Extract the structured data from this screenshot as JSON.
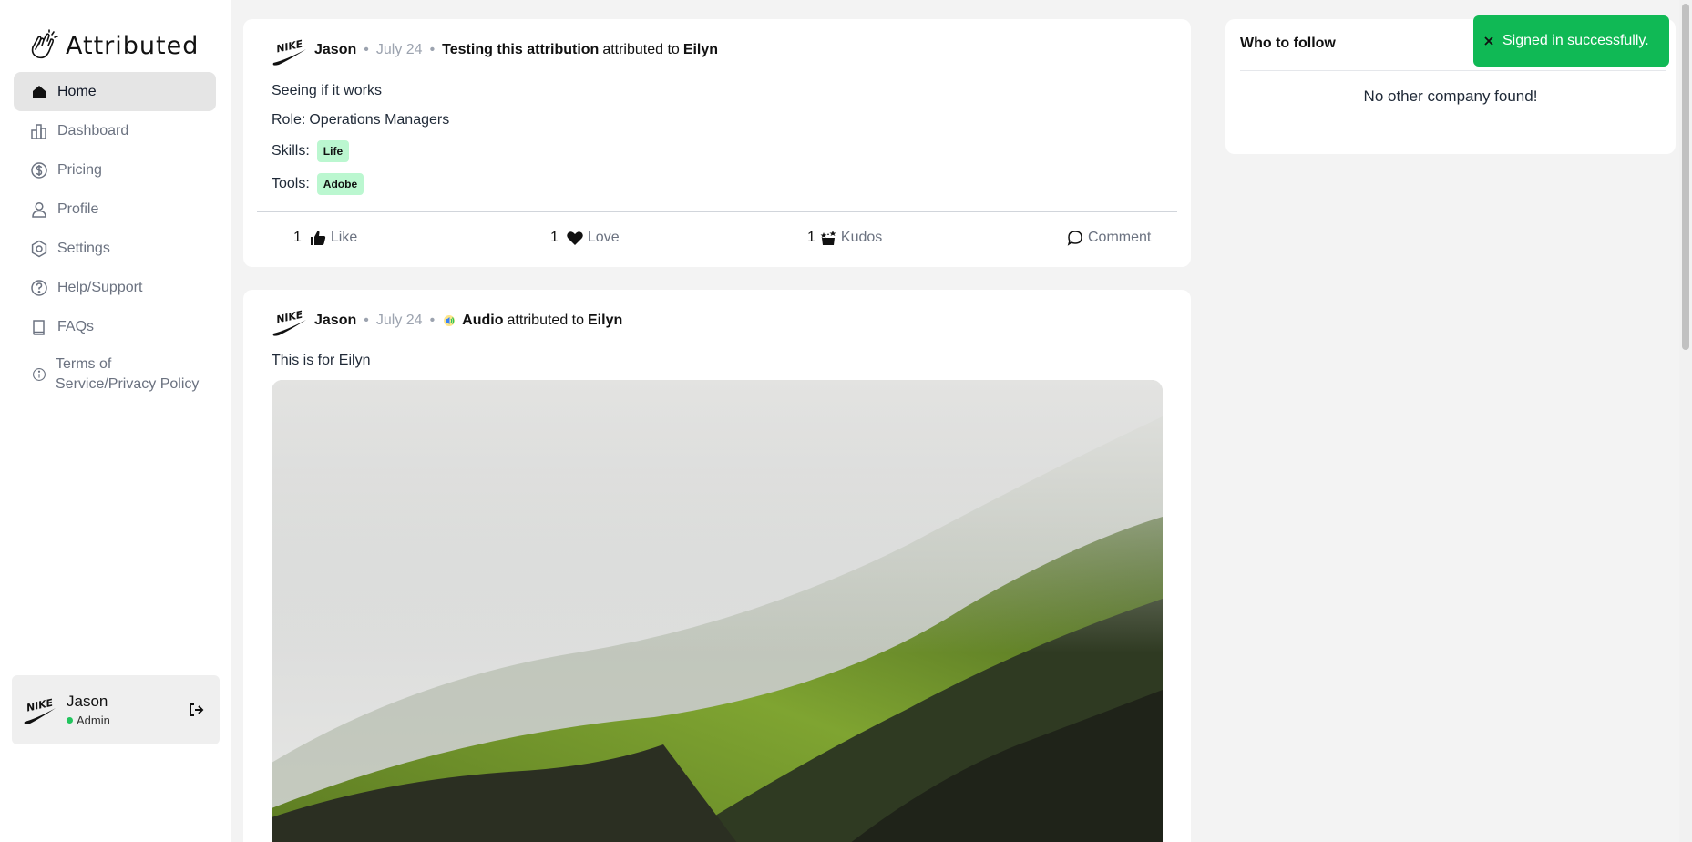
{
  "app": {
    "name": "Attributed"
  },
  "sidebar": {
    "items": [
      {
        "label": "Home",
        "icon": "home-icon",
        "active": true
      },
      {
        "label": "Dashboard",
        "icon": "bar-chart-icon",
        "active": false
      },
      {
        "label": "Pricing",
        "icon": "dollar-circle-icon",
        "active": false
      },
      {
        "label": "Profile",
        "icon": "user-icon",
        "active": false
      },
      {
        "label": "Settings",
        "icon": "gear-icon",
        "active": false
      },
      {
        "label": "Help/Support",
        "icon": "help-circle-icon",
        "active": false
      },
      {
        "label": "FAQs",
        "icon": "book-icon",
        "active": false
      },
      {
        "label_line1": "Terms of",
        "label_line2": "Service/Privacy Policy",
        "icon": "info-icon",
        "active": false
      }
    ],
    "user": {
      "name": "Jason",
      "role": "Admin",
      "status_color": "#22c55e"
    }
  },
  "posts": [
    {
      "author": "Jason",
      "date": "July 24",
      "title": "Testing this attribution",
      "attributed_text": "attributed to",
      "recipient": "Eilyn",
      "body": "Seeing if it works",
      "role_label": "Role:",
      "role": "Operations Managers",
      "skills_label": "Skills:",
      "skills": [
        "Life"
      ],
      "tools_label": "Tools:",
      "tools": [
        "Adobe"
      ],
      "actions": {
        "like": {
          "count": "1",
          "label": "Like"
        },
        "love": {
          "count": "1",
          "label": "Love"
        },
        "kudos": {
          "count": "1",
          "label": "Kudos"
        },
        "comment": {
          "label": "Comment"
        }
      }
    },
    {
      "author": "Jason",
      "date": "July 24",
      "title": "Audio",
      "attributed_text": "attributed to",
      "recipient": "Eilyn",
      "body": "This is for Eilyn"
    }
  ],
  "follow": {
    "title": "Who to follow",
    "empty": "No other company found!"
  },
  "toast": {
    "message": "Signed in successfully.",
    "color": "#10b955"
  },
  "colors": {
    "accent": "#10b955",
    "tag_bg": "#bbf7d0"
  }
}
